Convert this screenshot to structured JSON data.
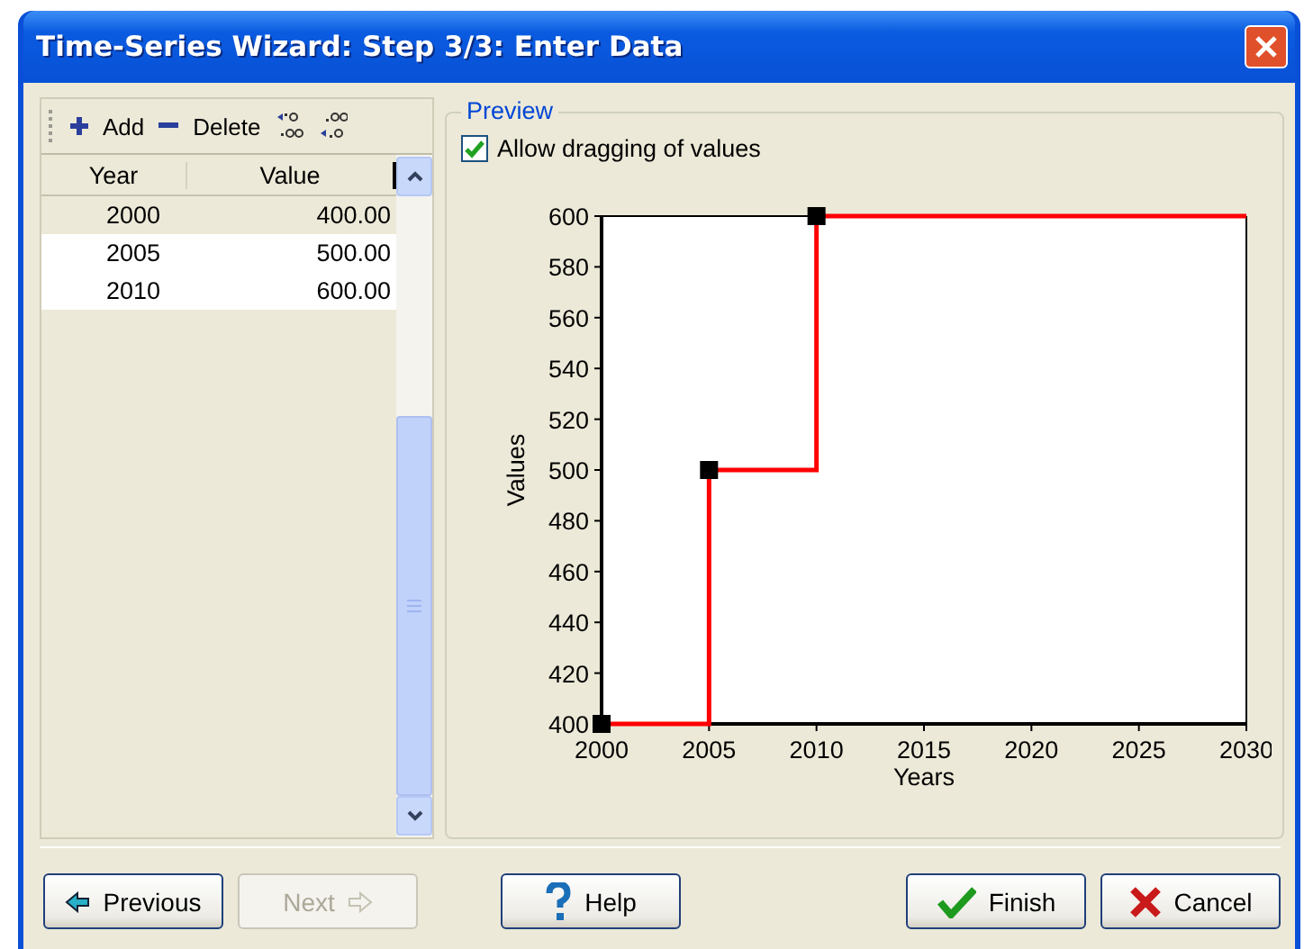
{
  "window": {
    "title": "Time-Series Wizard: Step 3/3: Enter Data"
  },
  "toolbar": [
    {
      "kind": "add",
      "label": "Add"
    },
    {
      "kind": "delete",
      "label": "Delete"
    },
    {
      "kind": "more-decimals"
    },
    {
      "kind": "fewer-decimals"
    }
  ],
  "table": {
    "columns": [
      "Year",
      "Value"
    ],
    "rows": [
      {
        "year": "2000",
        "value": "400.00",
        "selected": true
      },
      {
        "year": "2005",
        "value": "500.00",
        "selected": false
      },
      {
        "year": "2010",
        "value": "600.00",
        "selected": false
      }
    ]
  },
  "preview": {
    "title": "Preview",
    "allow_dragging": {
      "label": "Allow dragging of values",
      "checked": true
    },
    "chart_data": {
      "type": "line",
      "xlabel": "Years",
      "ylabel": "Values",
      "x": [
        2000,
        2005,
        2005,
        2010,
        2010,
        2030
      ],
      "series": [
        {
          "color": "#ff0000",
          "marker": "square",
          "values": [
            400,
            400,
            500,
            500,
            600,
            600
          ]
        }
      ],
      "xlim": [
        2000,
        2030
      ],
      "ylim": [
        400,
        600
      ],
      "xticks": [
        2000,
        2005,
        2010,
        2015,
        2020,
        2025,
        2030
      ],
      "yticks": [
        400,
        420,
        440,
        460,
        480,
        500,
        520,
        540,
        560,
        580,
        600
      ]
    }
  },
  "buttons": [
    {
      "kind": "previous",
      "label": "Previous",
      "disabled": false
    },
    {
      "kind": "next",
      "label": "Next",
      "disabled": true
    },
    {
      "kind": "help",
      "label": "Help",
      "disabled": false
    },
    {
      "kind": "finish",
      "label": "Finish",
      "disabled": false
    },
    {
      "kind": "cancel",
      "label": "Cancel",
      "disabled": false
    }
  ]
}
